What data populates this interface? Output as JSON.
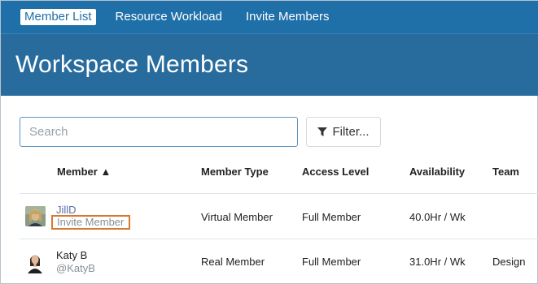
{
  "nav": {
    "tabs": [
      {
        "label": "Member List",
        "active": true
      },
      {
        "label": "Resource Workload",
        "active": false
      },
      {
        "label": "Invite Members",
        "active": false
      }
    ]
  },
  "header": {
    "title": "Workspace Members"
  },
  "search": {
    "placeholder": "Search",
    "value": ""
  },
  "filter": {
    "label": "Filter...",
    "icon": "funnel-icon"
  },
  "table": {
    "columns": [
      "Member ▲",
      "Member Type",
      "Access Level",
      "Availability",
      "Team"
    ],
    "rows": [
      {
        "name": "JillD",
        "subtext": "Invite Member",
        "type": "Virtual Member",
        "access": "Full Member",
        "availability": "40.0Hr / Wk",
        "team": ""
      },
      {
        "name": "Katy B",
        "subtext": "@KatyB",
        "type": "Real Member",
        "access": "Full Member",
        "availability": "31.0Hr / Wk",
        "team": "Design"
      }
    ]
  },
  "colors": {
    "nav_bg": "#1f6fa8",
    "header_bg": "#286c9d",
    "highlight": "#d7782c",
    "link": "#5b6fa9"
  }
}
